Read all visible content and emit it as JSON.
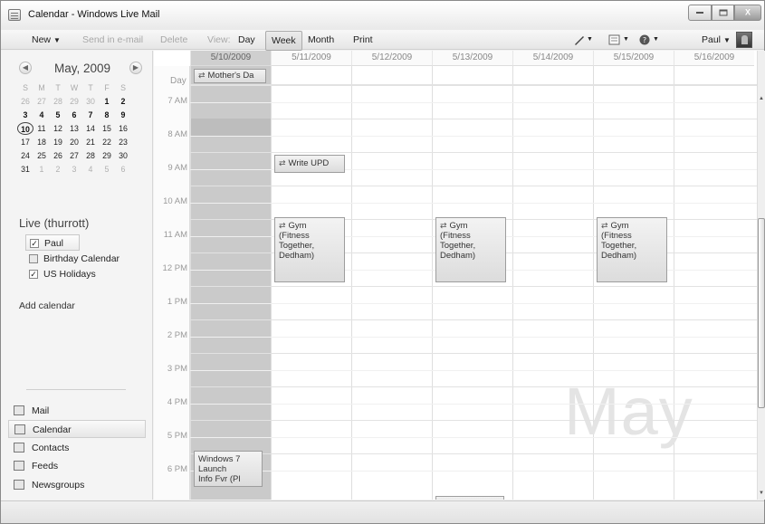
{
  "window": {
    "title": "Calendar - Windows Live Mail",
    "controls": {
      "minimize": "minimize",
      "maximize": "maximize",
      "close": "X"
    }
  },
  "toolbar": {
    "new": "New",
    "send_in_email": "Send in e-mail",
    "delete": "Delete",
    "view": "View:",
    "day": "Day",
    "week": "Week",
    "month": "Month",
    "print": "Print",
    "user": "Paul",
    "active_view": "Week"
  },
  "mini_calendar": {
    "title": "May, 2009",
    "dow": [
      "S",
      "M",
      "T",
      "W",
      "T",
      "F",
      "S"
    ],
    "weeks": [
      [
        {
          "d": "26",
          "o": true
        },
        {
          "d": "27",
          "o": true
        },
        {
          "d": "28",
          "o": true
        },
        {
          "d": "29",
          "o": true
        },
        {
          "d": "30",
          "o": true
        },
        {
          "d": "1"
        },
        {
          "d": "2"
        }
      ],
      [
        {
          "d": "3"
        },
        {
          "d": "4"
        },
        {
          "d": "5"
        },
        {
          "d": "6"
        },
        {
          "d": "7"
        },
        {
          "d": "8"
        },
        {
          "d": "9"
        }
      ],
      [
        {
          "d": "10",
          "today": true
        },
        {
          "d": "11",
          "p": true
        },
        {
          "d": "12",
          "p": true
        },
        {
          "d": "13",
          "p": true
        },
        {
          "d": "14",
          "p": true
        },
        {
          "d": "15",
          "p": true
        },
        {
          "d": "16",
          "p": true
        }
      ],
      [
        {
          "d": "17",
          "p": true
        },
        {
          "d": "18",
          "p": true
        },
        {
          "d": "19",
          "p": true
        },
        {
          "d": "20",
          "p": true
        },
        {
          "d": "21",
          "p": true
        },
        {
          "d": "22",
          "p": true
        },
        {
          "d": "23",
          "p": true
        }
      ],
      [
        {
          "d": "24",
          "p": true
        },
        {
          "d": "25",
          "p": true
        },
        {
          "d": "26",
          "p": true
        },
        {
          "d": "27",
          "p": true
        },
        {
          "d": "28",
          "p": true
        },
        {
          "d": "29",
          "p": true
        },
        {
          "d": "30",
          "p": true
        }
      ],
      [
        {
          "d": "31",
          "p": true
        },
        {
          "d": "1",
          "o": true
        },
        {
          "d": "2",
          "o": true
        },
        {
          "d": "3",
          "o": true
        },
        {
          "d": "4",
          "o": true
        },
        {
          "d": "5",
          "o": true
        },
        {
          "d": "6",
          "o": true
        }
      ]
    ]
  },
  "account": {
    "name": "Live (thurrott)",
    "calendars": [
      {
        "label": "Paul",
        "checked": true
      },
      {
        "label": "Birthday Calendar",
        "checked": false
      },
      {
        "label": "US Holidays",
        "checked": true
      }
    ],
    "add_calendar": "Add calendar"
  },
  "nav": [
    {
      "label": "Mail",
      "icon": "mail-icon"
    },
    {
      "label": "Calendar",
      "icon": "calendar-icon",
      "selected": true
    },
    {
      "label": "Contacts",
      "icon": "contacts-icon"
    },
    {
      "label": "Feeds",
      "icon": "feeds-icon"
    },
    {
      "label": "Newsgroups",
      "icon": "newsgroups-icon"
    }
  ],
  "week": {
    "dates": [
      "5/10/2009",
      "5/11/2009",
      "5/12/2009",
      "5/13/2009",
      "5/14/2009",
      "5/15/2009",
      "5/16/2009"
    ],
    "selected_day": "5/10/2009",
    "allday_label": "Day",
    "hours": [
      "7 AM",
      "8 AM",
      "9 AM",
      "10 AM",
      "11 AM",
      "12 PM",
      "1 PM",
      "2 PM",
      "3 PM",
      "4 PM",
      "5 PM",
      "6 PM"
    ],
    "watermark": "May"
  },
  "events": {
    "mothers_day": "Mother's Da",
    "write_upd": "Write UPD",
    "gym": "Gym\n(Fitness\nTogether,\nDedham)",
    "win7": "Windows 7\nLaunch\nInfo Fvr (Pl"
  },
  "colors": {
    "selected_day": "#cacaca",
    "event_border": "#9d9d9d",
    "watermark": "#e4e4e4"
  }
}
